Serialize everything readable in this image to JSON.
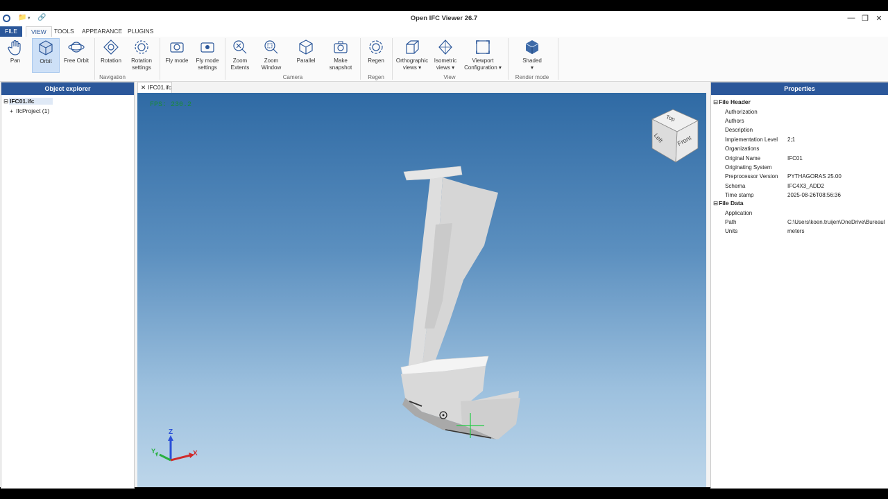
{
  "app": {
    "title": "Open IFC Viewer 26.7"
  },
  "menu": {
    "file": "FILE",
    "view": "VIEW",
    "tools": "TOOLS",
    "appearance": "APPEARANCE",
    "plugins": "PLUGINS"
  },
  "ribbon": {
    "pan": "Pan",
    "orbit": "Orbit",
    "free_orbit": "Free Orbit",
    "rotation": "Rotation",
    "rotation_settings_1": "Rotation",
    "rotation_settings_2": "settings",
    "fly_mode": "Fly mode",
    "fly_mode_settings_1": "Fly mode",
    "fly_mode_settings_2": "settings",
    "zoom_extents_1": "Zoom",
    "zoom_extents_2": "Extents",
    "zoom_window_1": "Zoom",
    "zoom_window_2": "Window",
    "parallel": "Parallel",
    "snapshot_1": "Make",
    "snapshot_2": "snapshot",
    "regen": "Regen",
    "ortho_1": "Orthographic",
    "ortho_2": "views",
    "iso_1": "Isometric",
    "iso_2": "views",
    "viewport_1": "Viewport",
    "viewport_2": "Configuration",
    "shaded": "Shaded",
    "groups": {
      "navigation": "Navigation",
      "camera": "Camera",
      "regen": "Regen",
      "view": "View",
      "render": "Render mode"
    }
  },
  "explorer": {
    "title": "Object explorer",
    "root": "IFC01.ifc",
    "child": "IfcProject (1)"
  },
  "document_tab": {
    "label": "IFC01.ifc"
  },
  "viewport": {
    "fps": "FPS: 230.2",
    "cube": {
      "top": "Top",
      "left": "Left",
      "front": "Front"
    },
    "axes": {
      "x": "X",
      "y": "Y",
      "z": "Z"
    }
  },
  "properties": {
    "title": "Properties",
    "file_header": "File Header",
    "header_rows": [
      {
        "k": "Authorization",
        "v": ""
      },
      {
        "k": "Authors",
        "v": ""
      },
      {
        "k": "Description",
        "v": ""
      },
      {
        "k": "Implementation Level",
        "v": "2;1"
      },
      {
        "k": "Organizations",
        "v": ""
      },
      {
        "k": "Original Name",
        "v": "IFC01"
      },
      {
        "k": "Originating System",
        "v": ""
      },
      {
        "k": "Preprocessor Version",
        "v": "PYTHAGORAS 25.00"
      },
      {
        "k": "Schema",
        "v": "IFC4X3_ADD2"
      },
      {
        "k": "Time stamp",
        "v": "2025-08-26T08:56:36"
      }
    ],
    "file_data": "File Data",
    "data_rows": [
      {
        "k": "Application",
        "v": ""
      },
      {
        "k": "Path",
        "v": "C:\\Users\\koen.truijen\\OneDrive\\Bureaul"
      },
      {
        "k": "Units",
        "v": "meters"
      }
    ]
  },
  "colors": {
    "accent": "#2b579a",
    "fps": "#1b8a3a"
  }
}
